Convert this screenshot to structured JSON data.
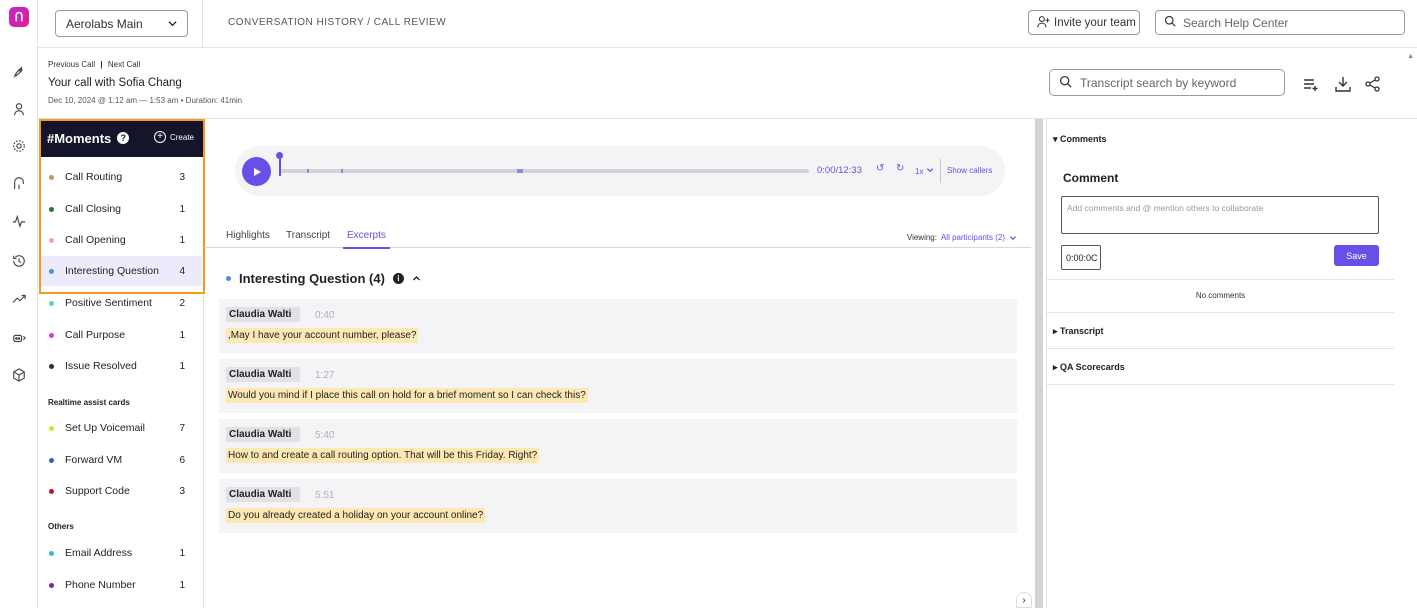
{
  "app": {
    "logo_glyph": "ᑎ",
    "accent": "#6a4ee8",
    "moments_header_bg": "#14142b",
    "highlight_frame": "#f59b1a"
  },
  "rail": [
    "rocket-icon",
    "user-icon",
    "gear-icon",
    "route-icon",
    "pulse-icon",
    "history-icon",
    "trend-icon",
    "bot-icon",
    "cube-icon"
  ],
  "topbar": {
    "workspace": "Aerolabs Main",
    "breadcrumb": "CONVERSATION HISTORY / CALL REVIEW",
    "invite_label": "Invite your team",
    "help_placeholder": "Search Help Center"
  },
  "call": {
    "previous": "Previous Call",
    "separator": "|",
    "next": "Next Call",
    "title": "Your call with Sofia Chang",
    "meta": "Dec 10, 2024 @ 1:12 am — 1:53 am • Duration: 41min",
    "search_placeholder": "Transcript search by keyword"
  },
  "moments": {
    "title": "#Moments",
    "help": "?",
    "create": "Create",
    "items": [
      {
        "label": "Call Routing",
        "count": "3",
        "color": "#b89a72"
      },
      {
        "label": "Call Closing",
        "count": "1",
        "color": "#1f7a3a"
      },
      {
        "label": "Call Opening",
        "count": "1",
        "color": "#f39ad8"
      },
      {
        "label": "Interesting Question",
        "count": "4",
        "color": "#4a90e2"
      },
      {
        "label": "Positive Sentiment",
        "count": "2",
        "color": "#5fd4b0"
      },
      {
        "label": "Call Purpose",
        "count": "1",
        "color": "#d63ed0"
      },
      {
        "label": "Issue Resolved",
        "count": "1",
        "color": "#24323a"
      }
    ],
    "realtime_title": "Realtime assist cards",
    "realtime": [
      {
        "label": "Set Up Voicemail",
        "count": "7",
        "color": "#d6e12a"
      },
      {
        "label": "Forward VM",
        "count": "6",
        "color": "#2563d6"
      },
      {
        "label": "Support Code",
        "count": "3",
        "color": "#c4122f"
      }
    ],
    "others_title": "Others",
    "others": [
      {
        "label": "Email Address",
        "count": "1",
        "color": "#3ab0e0"
      },
      {
        "label": "Phone Number",
        "count": "1",
        "color": "#6b2fa0"
      }
    ]
  },
  "player": {
    "progress": 0.0,
    "time": "0:00/12:33",
    "back": "↺",
    "fwd": "↻",
    "speed": "1x",
    "show_callers": "Show callers"
  },
  "tabs": {
    "highlights": "Highlights",
    "transcript": "Transcript",
    "excerpts": "Excerpts",
    "viewing_label": "Viewing:",
    "viewing_value": "All participants (2)"
  },
  "excerpts": {
    "title": "Interesting Question (4)",
    "items": [
      {
        "speaker": "Claudia Walti",
        "time": "0:40",
        "text": ",May I have your account number, please?"
      },
      {
        "speaker": "Claudia Walti",
        "time": "1:27",
        "text": "Would you mind if I place this call on hold for a brief moment so I can check this?"
      },
      {
        "speaker": "Claudia Walti",
        "time": "5:40",
        "text": "How to and create a call routing option. That will be this Friday. Right?"
      },
      {
        "speaker": "Claudia Walti",
        "time": "5:51",
        "text": "Do you already created a holiday on your account online?"
      }
    ]
  },
  "right": {
    "comments_section": "▾ Comments",
    "comment_title": "Comment",
    "comment_placeholder": "Add comments and @ mention others to collaborate",
    "time_value": "0:00:0C",
    "save": "Save",
    "no_comments": "No comments",
    "transcript_section": "▸ Transcript",
    "qa_section": "▸ QA Scorecards"
  }
}
